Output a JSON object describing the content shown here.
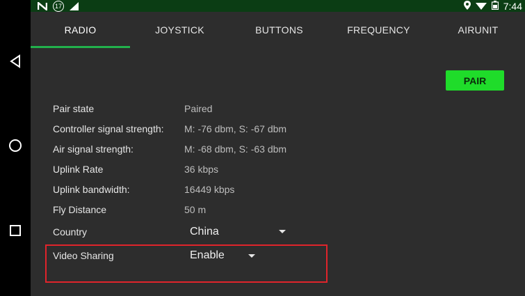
{
  "status": {
    "time": "7:44",
    "notif_badge": "17",
    "left_icons": [
      "n-logo-icon",
      "badge-17-icon",
      "signal-icon"
    ],
    "right_icons": [
      "location-icon",
      "wifi-icon",
      "battery-icon"
    ]
  },
  "tabs": [
    {
      "label": "RADIO",
      "active": true
    },
    {
      "label": "JOYSTICK",
      "active": false
    },
    {
      "label": "BUTTONS",
      "active": false
    },
    {
      "label": "FREQUENCY",
      "active": false
    },
    {
      "label": "AIRUNIT",
      "active": false
    }
  ],
  "pair_button": "PAIR",
  "accent_color": "#22b14c",
  "pair_color": "#1fdc2a",
  "highlight_color": "#e0242b",
  "info": [
    {
      "label": "Pair state",
      "value": "Paired"
    },
    {
      "label": "Controller signal strength:",
      "value": "M: -76 dbm, S: -67 dbm"
    },
    {
      "label": "Air signal strength:",
      "value": "M: -68 dbm, S: -63 dbm"
    },
    {
      "label": "Uplink Rate",
      "value": "36 kbps"
    },
    {
      "label": "Uplink bandwidth:",
      "value": "16449 kbps"
    },
    {
      "label": "Fly Distance",
      "value": "50 m"
    }
  ],
  "country": {
    "label": "Country",
    "value": "China"
  },
  "video_sharing": {
    "label": "Video Sharing",
    "value": "Enable"
  },
  "nav": [
    "back-icon",
    "home-icon",
    "recents-icon"
  ]
}
